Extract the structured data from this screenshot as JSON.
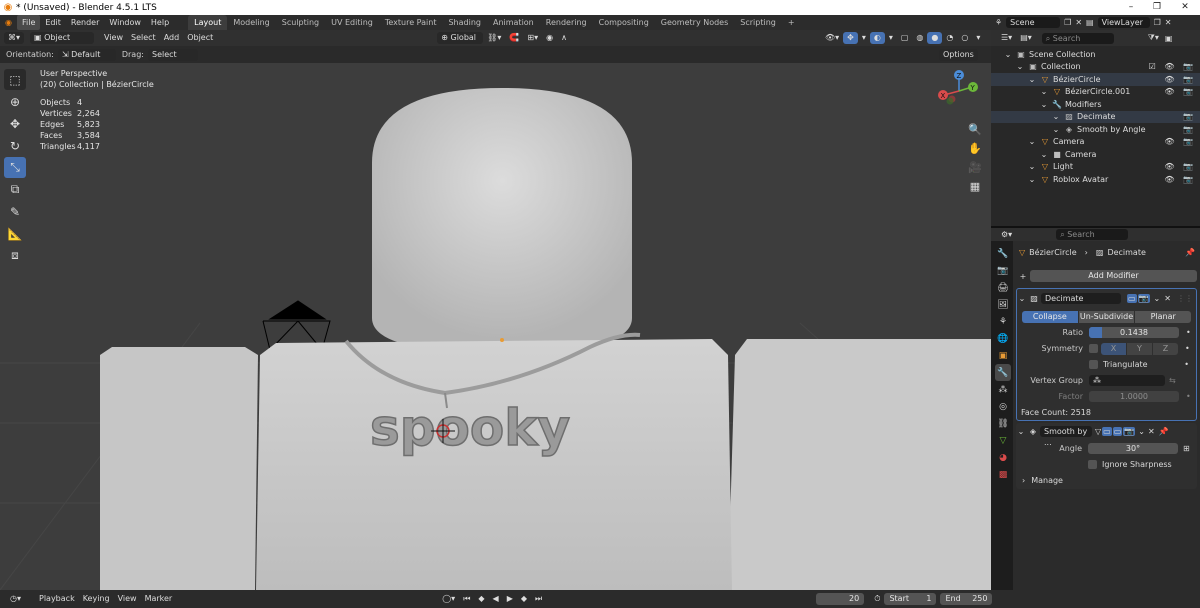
{
  "titlebar": {
    "title": "* (Unsaved) - Blender 4.5.1 LTS",
    "minimize": "–",
    "restore": "❐",
    "close": "✕"
  },
  "menu": [
    "File",
    "Edit",
    "Render",
    "Window",
    "Help"
  ],
  "workspaces": [
    "Layout",
    "Modeling",
    "Sculpting",
    "UV Editing",
    "Texture Paint",
    "Shading",
    "Animation",
    "Rendering",
    "Compositing",
    "Geometry Nodes",
    "Scripting"
  ],
  "add_workspace": "+",
  "scene": {
    "scene": "Scene",
    "view_layer": "ViewLayer"
  },
  "viewport_header": {
    "mode": "Object Mode",
    "view": "View",
    "select": "Select",
    "add": "Add",
    "object": "Object",
    "transform": "Global"
  },
  "tool_settings": {
    "orientation_label": "Orientation:",
    "orientation": "Default",
    "drag_label": "Drag:",
    "drag": "Select Box",
    "options": "Options"
  },
  "viewport": {
    "view_name": "User Perspective",
    "collection_line": "(20) Collection | BézierCircle",
    "stats": [
      {
        "k": "Objects",
        "v": "4"
      },
      {
        "k": "Vertices",
        "v": "2,264"
      },
      {
        "k": "Edges",
        "v": "5,823"
      },
      {
        "k": "Faces",
        "v": "3,584"
      },
      {
        "k": "Triangles",
        "v": "4,117"
      }
    ],
    "pendant_text": "spooky",
    "gizmo": {
      "x": "X",
      "y": "Y",
      "z": "Z"
    }
  },
  "outliner": {
    "search_placeholder": "Search",
    "rows": [
      {
        "label": "Scene Collection",
        "indent": 1,
        "icon": "▣",
        "vis": ""
      },
      {
        "label": "Collection",
        "indent": 2,
        "icon": "▣",
        "vis": "☑ 👁 📷"
      },
      {
        "label": "BézierCircle",
        "indent": 3,
        "icon": "▽",
        "vis": "👁 📷",
        "hl": true
      },
      {
        "label": "BézierCircle.001",
        "indent": 4,
        "icon": "▽",
        "vis": "👁 📷"
      },
      {
        "label": "Modifiers",
        "indent": 4,
        "icon": "🔧",
        "vis": ""
      },
      {
        "label": "Decimate",
        "indent": 5,
        "icon": "▨",
        "vis": "📷",
        "hl": true
      },
      {
        "label": "Smooth by Angle",
        "indent": 5,
        "icon": "◈",
        "vis": "📷"
      },
      {
        "label": "Camera",
        "indent": 3,
        "icon": "▽",
        "vis": "👁 📷"
      },
      {
        "label": "Camera",
        "indent": 4,
        "icon": "■",
        "vis": ""
      },
      {
        "label": "Light",
        "indent": 3,
        "icon": "▽",
        "vis": "👁 📷"
      },
      {
        "label": "Roblox Avatar",
        "indent": 3,
        "icon": "▽",
        "vis": "👁 📷"
      }
    ]
  },
  "properties": {
    "search_placeholder": "Search",
    "breadcrumb_object": "BézierCircle",
    "breadcrumb_modifier": "Decimate",
    "add_modifier": "Add Modifier",
    "decimate": {
      "name": "Decimate",
      "tabs": [
        "Collapse",
        "Un-Subdivide",
        "Planar"
      ],
      "ratio_label": "Ratio",
      "ratio_value": "0.1438",
      "ratio": 0.1438,
      "symmetry_label": "Symmetry",
      "axes": [
        "X",
        "Y",
        "Z"
      ],
      "triangulate": "Triangulate",
      "vertex_group_label": "Vertex Group",
      "factor_label": "Factor",
      "factor_value": "1.0000",
      "face_count": "Face Count: 2518"
    },
    "smooth": {
      "name": "Smooth by ...",
      "angle_label": "Angle",
      "angle_value": "30°",
      "ignore_sharpness": "Ignore Sharpness",
      "manage": "Manage"
    }
  },
  "timeline": {
    "playback": "Playback",
    "keying": "Keying",
    "view": "View",
    "marker": "Marker",
    "current_frame": "20",
    "start_label": "Start",
    "start": "1",
    "end_label": "End",
    "end": "250"
  },
  "colors": {
    "accent": "#4772b3",
    "viewport_bg": "#3d3d3d",
    "mesh": "#c8c8c8"
  }
}
